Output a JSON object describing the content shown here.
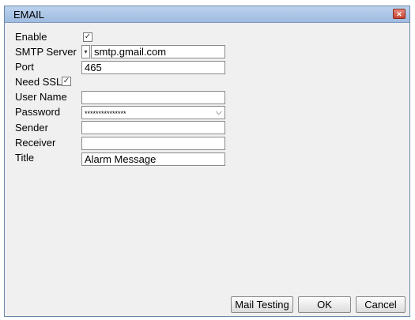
{
  "window": {
    "title": "EMAIL",
    "close_symbol": "✕"
  },
  "form": {
    "enable": {
      "label": "Enable",
      "checked": true,
      "mark": "✓"
    },
    "smtp_server": {
      "label": "SMTP Server",
      "value": "smtp.gmail.com",
      "dropdown_symbol": "▾"
    },
    "port": {
      "label": "Port",
      "value": "465"
    },
    "need_ssl": {
      "label": "Need SSL",
      "checked": true,
      "mark": "✓"
    },
    "user_name": {
      "label": "User Name",
      "value": ""
    },
    "password": {
      "label": "Password",
      "value": "***************",
      "chevron_symbol": "⌵"
    },
    "sender": {
      "label": "Sender",
      "value": ""
    },
    "receiver": {
      "label": "Receiver",
      "value": ""
    },
    "title": {
      "label": "Title",
      "value": "Alarm Message"
    }
  },
  "buttons": {
    "mail_testing": "Mail Testing",
    "ok": "OK",
    "cancel": "Cancel"
  },
  "colors": {
    "titlebar": "#a9c4e8",
    "close": "#d05a47",
    "window_bg": "#f0f0f0"
  }
}
